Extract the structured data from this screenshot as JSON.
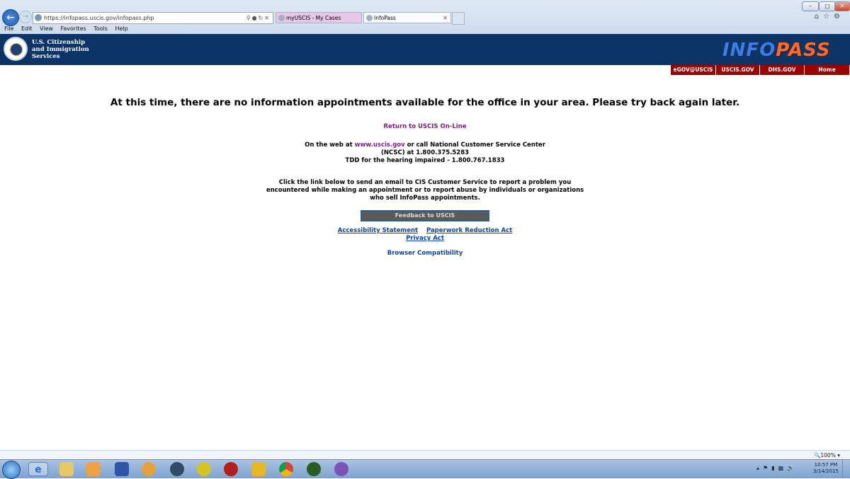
{
  "browser": {
    "url": "https://infopass.uscis.gov/infopass.php",
    "tabs": [
      {
        "label": "myUSCIS - My Cases"
      },
      {
        "label": "InfoPass"
      }
    ],
    "menu": [
      "File",
      "Edit",
      "View",
      "Favorites",
      "Tools",
      "Help"
    ],
    "zoom": "100%"
  },
  "header": {
    "agency_line1": "U.S. Citizenship",
    "agency_line2": "and Immigration",
    "agency_line3": "Services",
    "logo_part1": "INFO",
    "logo_part2": "PASS",
    "nav": [
      "eGOV@USCIS",
      "USCIS.GOV",
      "DHS.GOV",
      "Home"
    ]
  },
  "content": {
    "headline": "At this time, there are no information appointments available for the office in your area. Please try back again later.",
    "return_link": "Return to USCIS On-Line",
    "web_prefix": "On the web at ",
    "web_link": "www.uscis.gov",
    "web_suffix": " or call National Customer Service Center",
    "ncsc_line": "(NCSC) at 1.800.375.5283",
    "tdd_line": "TDD for the hearing impaired - 1.800.767.1833",
    "report_line1": "Click the link below to send an email to CIS Customer Service to report a problem you",
    "report_line2": "encountered while making an appointment or to report abuse by individuals or organizations",
    "report_line3": "who sell InfoPass appointments.",
    "feedback_button": "Feedback to USCIS",
    "accessibility_link": "Accessibility Statement",
    "paperwork_link": "Paperwork Reduction Act",
    "privacy_link": "Privacy Act",
    "browser_compat_link": "Browser Compatibility"
  },
  "taskbar": {
    "time": "10:57 PM",
    "date": "3/14/2015"
  },
  "colors": {
    "banner": "#0c3466",
    "nav_red": "#9c0000",
    "visited_link": "#7a1f7a",
    "link_blue": "#0645ad"
  }
}
